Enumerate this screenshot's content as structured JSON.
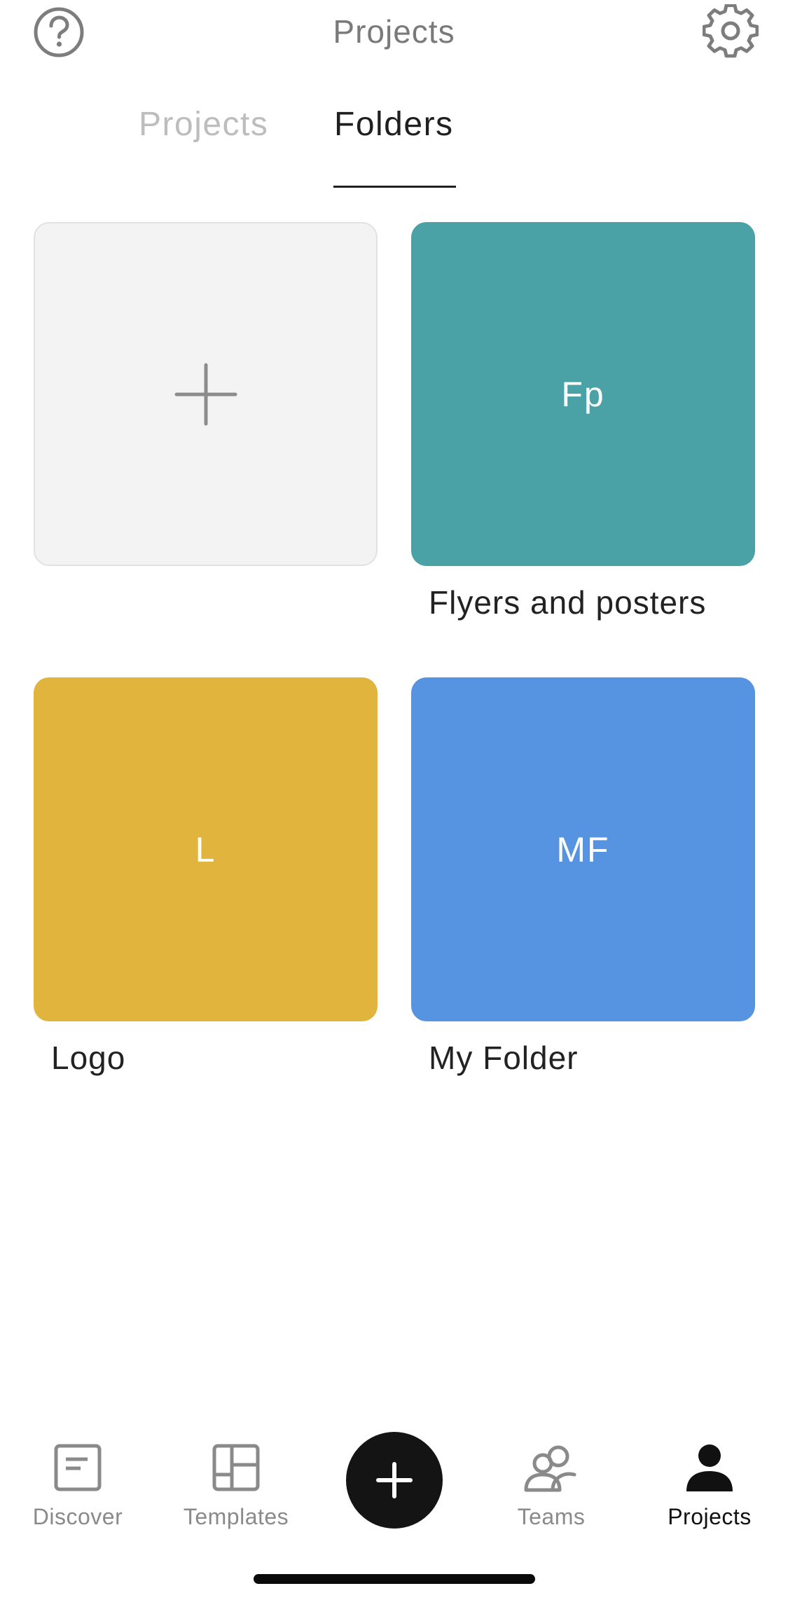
{
  "header": {
    "title": "Projects",
    "help_icon": "help-icon",
    "settings_icon": "gear-icon"
  },
  "tabs": [
    {
      "label": "Projects",
      "active": false
    },
    {
      "label": "Folders",
      "active": true
    }
  ],
  "folders": {
    "new_icon": "plus-icon",
    "items": [
      {
        "initials": "Fp",
        "name": "Flyers and posters",
        "color": "#4aa1a6"
      },
      {
        "initials": "L",
        "name": "Logo",
        "color": "#e1b43e"
      },
      {
        "initials": "MF",
        "name": "My Folder",
        "color": "#5694e2"
      }
    ]
  },
  "bottom_nav": {
    "items": [
      {
        "label": "Discover",
        "icon": "discover-icon",
        "active": false
      },
      {
        "label": "Templates",
        "icon": "templates-icon",
        "active": false
      },
      {
        "label": "Teams",
        "icon": "teams-icon",
        "active": false
      },
      {
        "label": "Projects",
        "icon": "projects-person-icon",
        "active": true
      }
    ],
    "create_icon": "plus-icon"
  },
  "colors": {
    "active_text": "#1f1f1f",
    "inactive_tab": "#bdbdbd",
    "nav_inactive": "#8a8a8a",
    "create_button": "#141414"
  }
}
